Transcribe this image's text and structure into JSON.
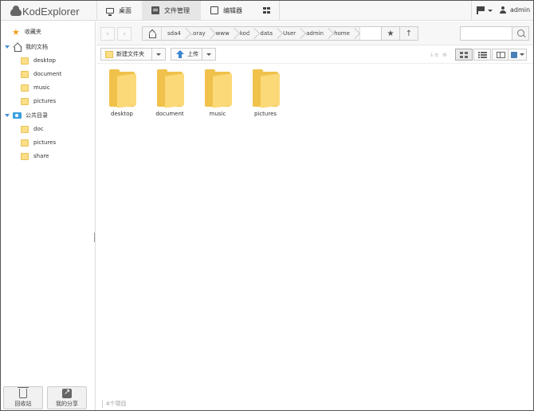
{
  "app": {
    "logo_text": "KodExplorer"
  },
  "top_nav": {
    "tabs": [
      {
        "label": "桌面",
        "icon": "desktop-icon"
      },
      {
        "label": "文件管理",
        "icon": "file-manager-icon",
        "active": true
      },
      {
        "label": "编辑器",
        "icon": "editor-icon"
      },
      {
        "label": "",
        "icon": "apps-grid-icon"
      }
    ],
    "user_name": "admin"
  },
  "sidebar": {
    "favorites_label": "收藏夹",
    "my_documents_label": "我的文档",
    "my_documents_items": [
      "desktop",
      "document",
      "music",
      "pictures"
    ],
    "public_label": "公共目录",
    "public_items": [
      "doc",
      "pictures",
      "share"
    ],
    "recycle_label": "回收站",
    "share_label": "我的分享"
  },
  "address_bar": {
    "breadcrumbs": [
      "sda4",
      ".oray",
      "www",
      "kod",
      "data",
      "User",
      "admin",
      "home"
    ],
    "search_placeholder": ""
  },
  "toolbar": {
    "new_folder_label": "新建文件夹",
    "upload_label": "上传"
  },
  "files": [
    {
      "name": "desktop",
      "type": "folder"
    },
    {
      "name": "document",
      "type": "folder"
    },
    {
      "name": "music",
      "type": "folder"
    },
    {
      "name": "pictures",
      "type": "folder"
    }
  ],
  "status": {
    "item_count": "4个项目"
  },
  "colors": {
    "folder": "#fcd978",
    "accent": "#3a85d0",
    "star": "#f0a020"
  }
}
